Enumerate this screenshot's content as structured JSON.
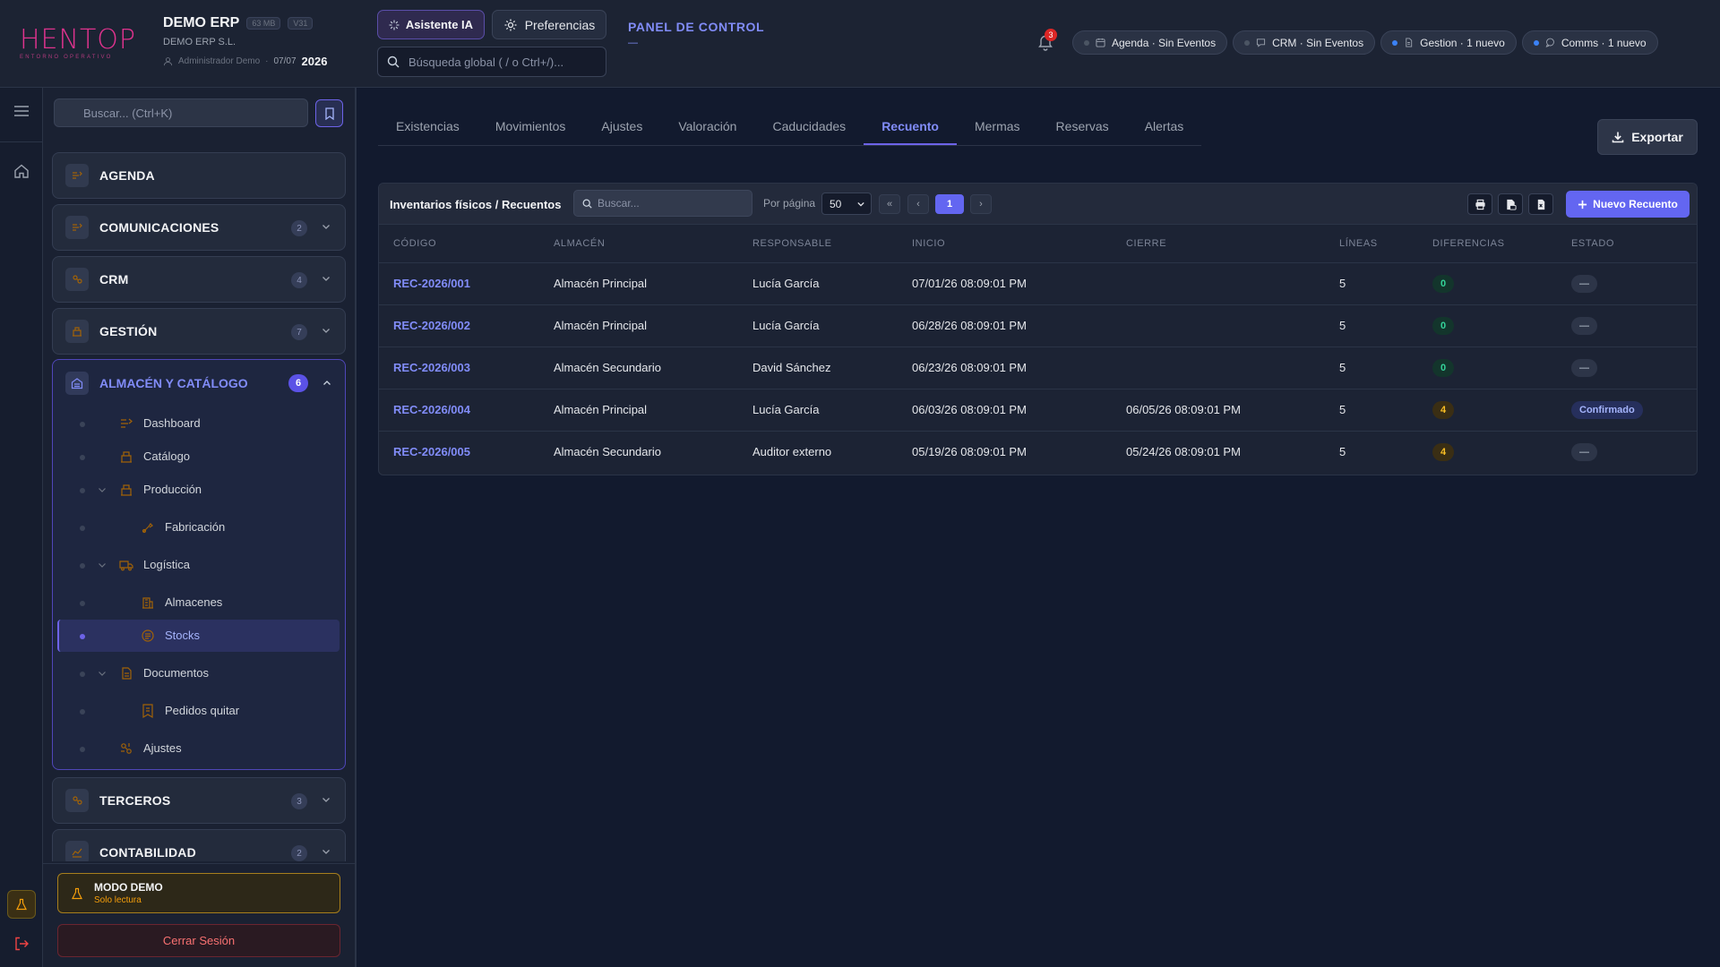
{
  "header": {
    "logo_text": "HENTOP",
    "logo_sub": "ENTORNO OPERATIVO",
    "company_name": "DEMO ERP",
    "size_badge": "63 MB",
    "version_badge": "V31",
    "company_legal": "DEMO ERP S.L.",
    "user": "Administrador Demo",
    "date": "07/07",
    "year": "2026",
    "ai_button": "Asistente IA",
    "prefs_button": "Preferencias",
    "search_placeholder": "Búsqueda global ( / o Ctrl+/)...",
    "panel_title": "PANEL DE CONTROL",
    "panel_sub": "—",
    "notifications_count": "3",
    "pills": [
      {
        "label": "Agenda · Sin Eventos",
        "active": false
      },
      {
        "label": "CRM · Sin Eventos",
        "active": false
      },
      {
        "label": "Gestion · 1 nuevo",
        "active": true
      },
      {
        "label": "Comms · 1 nuevo",
        "active": true
      }
    ]
  },
  "sidebar": {
    "search_placeholder": "Buscar... (Ctrl+K)",
    "sections": [
      {
        "label": "AGENDA",
        "count": ""
      },
      {
        "label": "COMUNICACIONES",
        "count": "2"
      },
      {
        "label": "CRM",
        "count": "4"
      },
      {
        "label": "GESTIÓN",
        "count": "7"
      }
    ],
    "open_section": {
      "label": "ALMACÉN Y CATÁLOGO",
      "count": "6",
      "items": [
        {
          "label": "Dashboard"
        },
        {
          "label": "Catálogo"
        },
        {
          "label": "Producción"
        },
        {
          "label": "Fabricación"
        },
        {
          "label": "Logística"
        },
        {
          "label": "Almacenes"
        },
        {
          "label": "Stocks"
        },
        {
          "label": "Documentos"
        },
        {
          "label": "Pedidos quitar"
        },
        {
          "label": "Ajustes"
        }
      ]
    },
    "sections_after": [
      {
        "label": "TERCEROS",
        "count": "3"
      },
      {
        "label": "CONTABILIDAD",
        "count": "2"
      }
    ],
    "demo_title": "MODO DEMO",
    "demo_sub": "Solo lectura",
    "logout": "Cerrar Sesión"
  },
  "tabs": [
    "Existencias",
    "Movimientos",
    "Ajustes",
    "Valoración",
    "Caducidades",
    "Recuento",
    "Mermas",
    "Reservas",
    "Alertas"
  ],
  "active_tab": "Recuento",
  "export_button": "Exportar",
  "table_card": {
    "title": "Inventarios físicos / Recuentos",
    "search_placeholder": "Buscar...",
    "per_page_label": "Por página",
    "per_page_value": "50",
    "page_first": "«",
    "page_prev": "‹",
    "page_current": "1",
    "page_next": "›",
    "new_button": "Nuevo Recuento",
    "columns": [
      "CÓDIGO",
      "ALMACÉN",
      "RESPONSABLE",
      "INICIO",
      "CIERRE",
      "LÍNEAS",
      "DIFERENCIAS",
      "ESTADO"
    ],
    "rows": [
      {
        "code": "REC-2026/001",
        "warehouse": "Almacén Principal",
        "owner": "Lucía García",
        "start": "07/01/26 08:09:01 PM",
        "end": "",
        "lines": "5",
        "diff": "0",
        "status": "—"
      },
      {
        "code": "REC-2026/002",
        "warehouse": "Almacén Principal",
        "owner": "Lucía García",
        "start": "06/28/26 08:09:01 PM",
        "end": "",
        "lines": "5",
        "diff": "0",
        "status": "—"
      },
      {
        "code": "REC-2026/003",
        "warehouse": "Almacén Secundario",
        "owner": "David Sánchez",
        "start": "06/23/26 08:09:01 PM",
        "end": "",
        "lines": "5",
        "diff": "0",
        "status": "—"
      },
      {
        "code": "REC-2026/004",
        "warehouse": "Almacén Principal",
        "owner": "Lucía García",
        "start": "06/03/26 08:09:01 PM",
        "end": "06/05/26 08:09:01 PM",
        "lines": "5",
        "diff": "4",
        "status": "Confirmado"
      },
      {
        "code": "REC-2026/005",
        "warehouse": "Almacén Secundario",
        "owner": "Auditor externo",
        "start": "05/19/26 08:09:01 PM",
        "end": "05/24/26 08:09:01 PM",
        "lines": "5",
        "diff": "4",
        "status": "—"
      }
    ]
  }
}
